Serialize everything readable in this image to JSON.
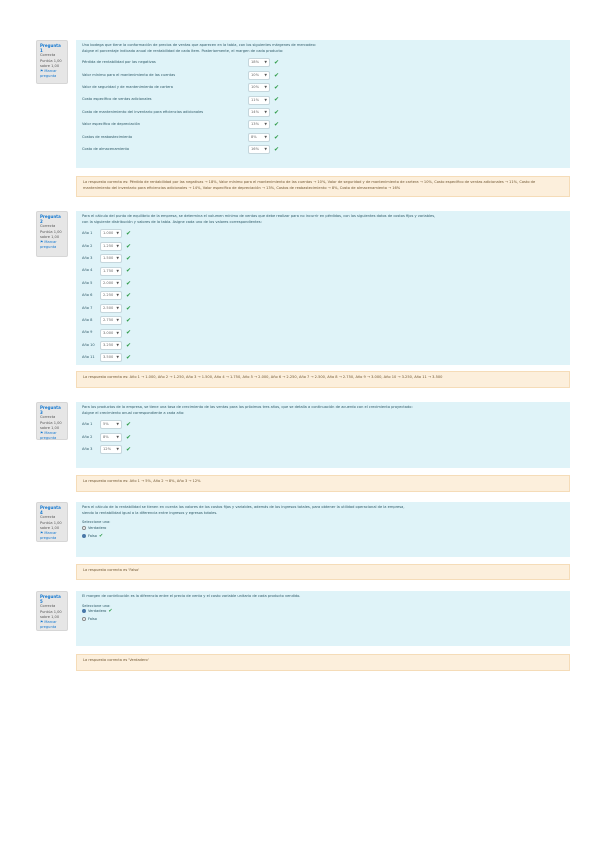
{
  "info_common": {
    "status": "Correcta",
    "score": "Puntúa 1,00 sobre 1,00",
    "flag": "Marcar pregunta"
  },
  "q1": {
    "number": "Pregunta 1",
    "text_1": "Una bodega que tiene la conformación de precios de ventas que aparecen en la tabla, con los siguientes márgenes de mercadeo:",
    "text_2": "Asigne el porcentaje indicado anual de rentabilidad de cada ítem. Posteriormente, el margen de cada producto:",
    "rows": [
      {
        "label": "Pérdida de rentabilidad por las negativas",
        "value": "18%"
      },
      {
        "label": "Valor mínimo para el mantenimiento de las cuentas",
        "value": "10%"
      },
      {
        "label": "Valor de seguridad y de mantenimiento de cartera",
        "value": "10%"
      },
      {
        "label": "Costo específico de ventas adicionales",
        "value": "11%"
      },
      {
        "label": "Costo de mantenimiento del inventario para eficiencias adicionales",
        "value": "14%"
      },
      {
        "label": "Valor específico de depreciación",
        "value": "13%"
      },
      {
        "label": "Costos de reabastecimiento",
        "value": "8%"
      },
      {
        "label": "Costo de almacenamiento",
        "value": "16%"
      }
    ],
    "feedback": "La respuesta correcta es: Pérdida de rentabilidad por las negativas → 18%, Valor mínimo para el mantenimiento de las cuentas → 10%, Valor de seguridad y de mantenimiento de cartera → 10%, Costo específico de ventas adicionales → 11%, Costo de mantenimiento del inventario para eficiencias adicionales → 14%, Valor específico de depreciación → 13%, Costos de reabastecimiento → 8%, Costo de almacenamiento → 16%"
  },
  "q2": {
    "number": "Pregunta 2",
    "text_1": "Para el cálculo del punto de equilibrio de la empresa, se determina el volumen mínimo de ventas que debe realizar para no incurrir en pérdidas, con los siguientes datos de costos fijos y variables,",
    "text_2": "con la siguiente distribución y valores de la tabla. Asigne cada uno de los valores correspondientes:",
    "rows": [
      {
        "label": "Año 1",
        "value": "1.000"
      },
      {
        "label": "Año 2",
        "value": "1.250"
      },
      {
        "label": "Año 3",
        "value": "1.500"
      },
      {
        "label": "Año 4",
        "value": "1.750"
      },
      {
        "label": "Año 5",
        "value": "2.000"
      },
      {
        "label": "Año 6",
        "value": "2.250"
      },
      {
        "label": "Año 7",
        "value": "2.500"
      },
      {
        "label": "Año 8",
        "value": "2.750"
      },
      {
        "label": "Año 9",
        "value": "3.000"
      },
      {
        "label": "Año 10",
        "value": "3.250"
      },
      {
        "label": "Año 11",
        "value": "3.500"
      }
    ],
    "feedback": "La respuesta correcta es: Año 1 → 1.000, Año 2 → 1.250, Año 3 → 1.500, Año 4 → 1.750, Año 5 → 2.000, Año 6 → 2.250, Año 7 → 2.500, Año 8 → 2.750, Año 9 → 3.000, Año 10 → 3.250, Año 11 → 3.500"
  },
  "q3": {
    "number": "Pregunta 3",
    "text_1": "Para los productos de la empresa, se tiene una tasa de crecimiento de las ventas para los próximos tres años, que se detalla a continuación de acuerdo con el crecimiento proyectado:",
    "text_2": "Asigne el crecimiento anual correspondiente a cada año:",
    "rows": [
      {
        "label": "Año 1",
        "value": "5%"
      },
      {
        "label": "Año 2",
        "value": "8%"
      },
      {
        "label": "Año 3",
        "value": "12%"
      }
    ],
    "feedback": "La respuesta correcta es: Año 1 → 5%, Año 2 → 8%, Año 3 → 12%"
  },
  "q4": {
    "number": "Pregunta 4",
    "text_1": "Para el cálculo de la rentabilidad se tienen en cuenta los valores de los costos fijos y variables, además de los ingresos totales, para obtener la utilidad operacional de la empresa,",
    "text_2": "siendo la rentabilidad igual a la diferencia entre ingresos y egresos totales.",
    "prompt": "Seleccione una:",
    "options": [
      {
        "label": "Verdadero",
        "selected": false,
        "correct": false
      },
      {
        "label": "Falso",
        "selected": true,
        "correct": true
      }
    ],
    "feedback": "La respuesta correcta es 'Falso'"
  },
  "q5": {
    "number": "Pregunta 5",
    "text_1": "El margen de contribución es la diferencia entre el precio de venta y el costo variable unitario de cada producto vendido.",
    "prompt": "Seleccione una:",
    "options": [
      {
        "label": "Verdadero",
        "selected": true,
        "correct": true
      },
      {
        "label": "Falso",
        "selected": false,
        "correct": false
      }
    ],
    "feedback": "La respuesta correcta es 'Verdadero'"
  }
}
